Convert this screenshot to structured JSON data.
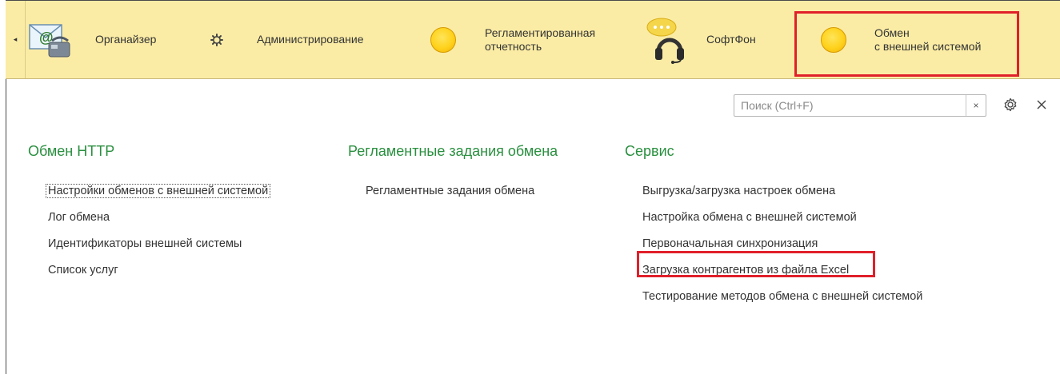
{
  "sections_panel": {
    "items": [
      {
        "label": "Органайзер",
        "icon": "organizer-mail-phone-icon"
      },
      {
        "label": "Администрирование",
        "icon": "gear-icon"
      },
      {
        "label": "Регламентированная\nотчетность",
        "icon": "yellow-circle-icon"
      },
      {
        "label": "СофтФон",
        "icon": "headset-chat-icon"
      },
      {
        "label": "Обмен\nс внешней системой",
        "icon": "yellow-circle-icon"
      }
    ],
    "scroll_left": "◂"
  },
  "search": {
    "placeholder": "Поиск (Ctrl+F)",
    "value": "",
    "clear": "×"
  },
  "columns": [
    {
      "title": "Обмен HTTP",
      "items": [
        "Настройки обменов с внешней системой",
        "Лог обмена",
        "Идентификаторы внешней системы",
        "Список услуг"
      ]
    },
    {
      "title": "Регламентные задания обмена",
      "items": [
        "Регламентные задания обмена"
      ]
    },
    {
      "title": "Сервис",
      "items": [
        "Выгрузка/загрузка настроек обмена",
        "Настройка обмена с внешней системой",
        "Первоначальная синхронизация",
        "Загрузка контрагентов из файла Excel",
        "Тестирование методов обмена с внешней системой"
      ]
    }
  ],
  "colors": {
    "panel_bg": "#fbeca5",
    "section_title": "#2a8f3f",
    "highlight": "#e0202a"
  }
}
